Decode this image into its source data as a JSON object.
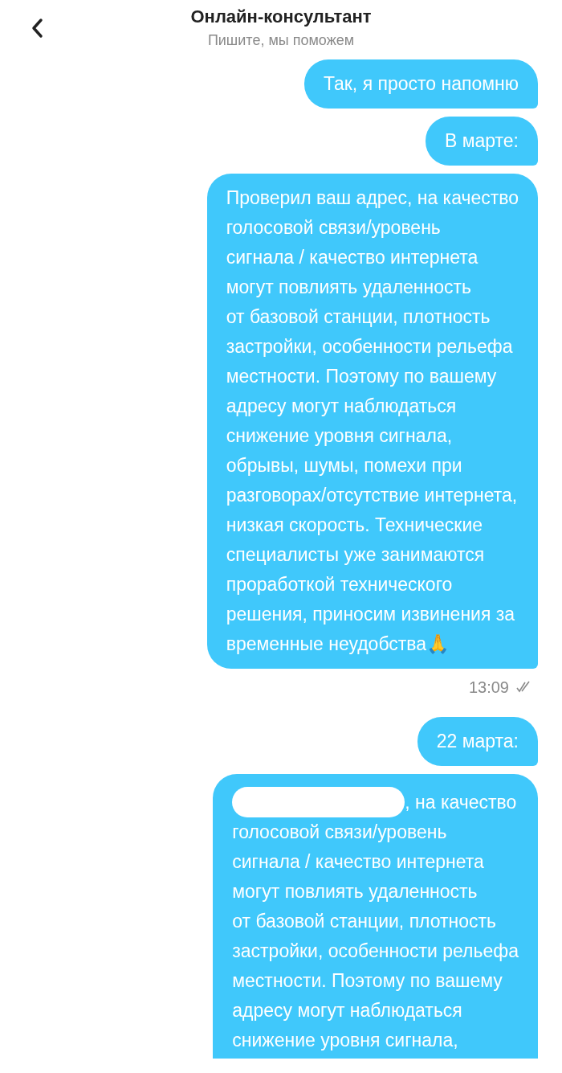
{
  "header": {
    "title": "Онлайн-консультант",
    "subtitle": "Пишите, мы поможем"
  },
  "messages": [
    {
      "kind": "text",
      "text": "Так, я просто напомню"
    },
    {
      "kind": "text",
      "text": "В марте:"
    },
    {
      "kind": "text",
      "text": "Проверил ваш адрес, на качество\nголосовой связи/уровень\nсигнала / качество интернета\nмогут повлиять удаленность\nот базовой станции, плотность\nзастройки, особенности рельефа\nместности. Поэтому по вашему\nадресу могут наблюдаться\nснижение уровня сигнала,\nобрывы, шумы, помехи при\nразговорах/отсутствие интернета,\nнизкая скорость. Технические\nспециалисты уже занимаются\nпроработкой технического\nрешения, приносим извинения за\nвременные неудобства🙏",
      "time": "13:09",
      "read": true
    },
    {
      "kind": "text",
      "text": "22 марта:"
    },
    {
      "kind": "redacted-cut",
      "text": ", на качество\nголосовой связи/уровень\nсигнала / качество интернета\nмогут повлиять удаленность\nот базовой станции, плотность\nзастройки, особенности рельефа\nместности. Поэтому по вашему\nадресу могут наблюдаться\nснижение уровня сигнала,"
    }
  ]
}
